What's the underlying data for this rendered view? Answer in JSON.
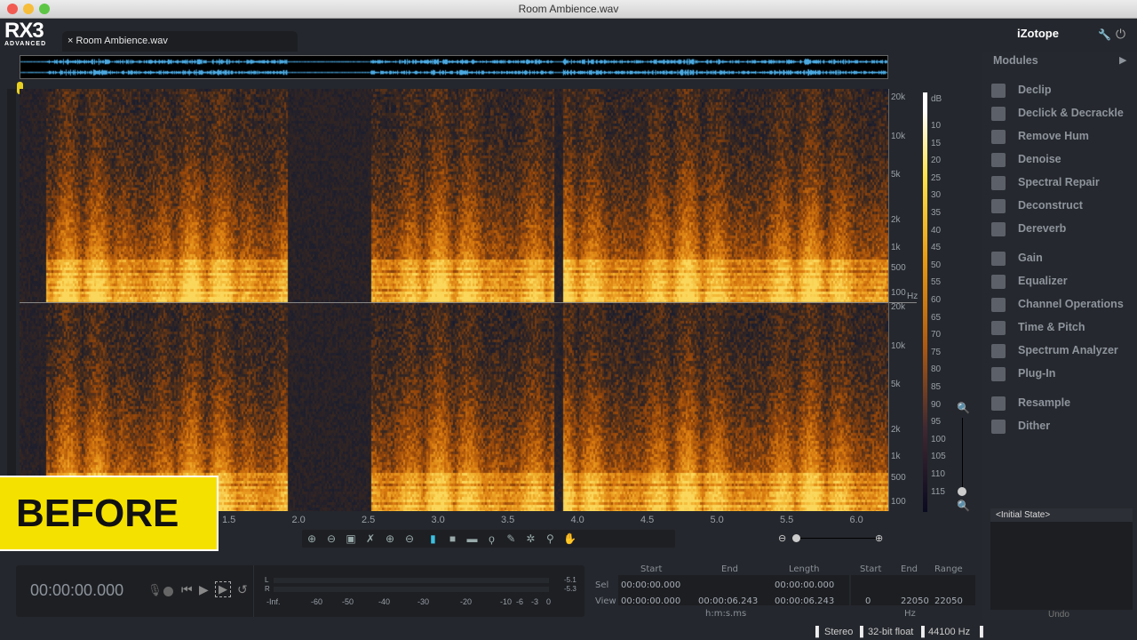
{
  "window": {
    "title": "Room Ambience.wav"
  },
  "app": {
    "logo": "RX3",
    "logo_sub": "ADVANCED",
    "brand": "iZotope"
  },
  "tab": {
    "close": "×",
    "label": "Room Ambience.wav"
  },
  "freq_axis": {
    "top": [
      "20k",
      "10k",
      "5k",
      "2k",
      "1k",
      "500",
      "100"
    ],
    "bottom": [
      "20k",
      "10k",
      "5k",
      "2k",
      "1k",
      "500",
      "100"
    ],
    "unit": "Hz"
  },
  "db_axis": {
    "unit": "dB",
    "labels": [
      "10",
      "15",
      "20",
      "25",
      "30",
      "35",
      "40",
      "45",
      "50",
      "55",
      "60",
      "65",
      "70",
      "75",
      "80",
      "85",
      "90",
      "95",
      "100",
      "105",
      "110",
      "115"
    ]
  },
  "time_axis": [
    "1.5",
    "2.0",
    "2.5",
    "3.0",
    "3.5",
    "4.0",
    "4.5",
    "5.0",
    "5.5",
    "6.0"
  ],
  "overlay": {
    "label": "BEFORE"
  },
  "modules": {
    "header": "Modules",
    "groups": [
      [
        "Declip",
        "Declick & Decrackle",
        "Remove Hum",
        "Denoise",
        "Spectral Repair",
        "Deconstruct",
        "Dereverb"
      ],
      [
        "Gain",
        "Equalizer",
        "Channel Operations",
        "Time & Pitch",
        "Spectrum Analyzer",
        "Plug-In"
      ],
      [
        "Resample",
        "Dither"
      ]
    ]
  },
  "undo": {
    "item": "<Initial State>",
    "label": "Undo"
  },
  "transport": {
    "time": "00:00:00.000",
    "meter_L": "L",
    "meter_R": "R",
    "peak_L": "-5.1",
    "peak_R": "-5.3",
    "scale": [
      "-Inf.",
      "-60",
      "-50",
      "-40",
      "-30",
      "-20",
      "-10",
      "-6",
      "-3",
      "0"
    ]
  },
  "selection": {
    "headers": [
      "Start",
      "End",
      "Length"
    ],
    "rows": [
      {
        "label": "Sel",
        "start": "00:00:00.000",
        "end": "",
        "length": "00:00:00.000"
      },
      {
        "label": "View",
        "start": "00:00:00.000",
        "end": "00:00:06.243",
        "length": "00:00:06.243"
      }
    ],
    "time_unit": "h:m:s.ms",
    "freq_headers": [
      "Start",
      "End",
      "Range"
    ],
    "freq_view": [
      "0",
      "22050",
      "22050"
    ],
    "freq_unit": "Hz"
  },
  "status": {
    "channels": "Stereo",
    "bit_depth": "32-bit float",
    "sample_rate": "44100 Hz"
  },
  "colors": {
    "accent": "#f5e100",
    "waveform": "#4aa8e0"
  }
}
